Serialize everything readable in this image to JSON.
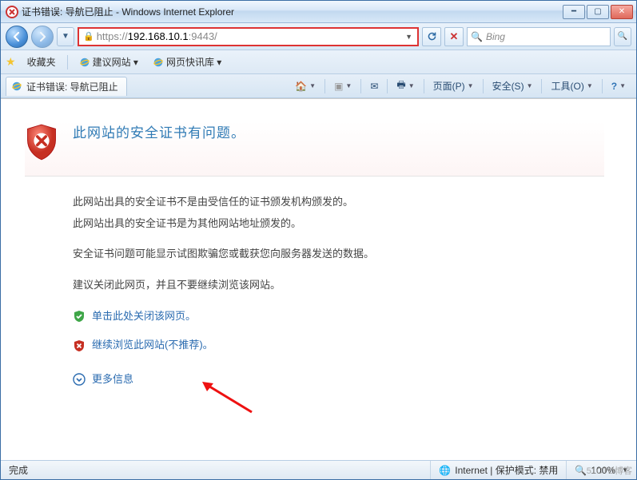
{
  "window": {
    "title": "证书错误: 导航已阻止 - Windows Internet Explorer"
  },
  "nav": {
    "url_scheme": "https://",
    "url_host": "192.168.10.1",
    "url_port": ":9443/",
    "search_placeholder": "Bing"
  },
  "favbar": {
    "label": "收藏夹",
    "suggested": "建议网站 ▾",
    "webslice": "网页快讯库 ▾"
  },
  "tab": {
    "title": "证书错误: 导航已阻止"
  },
  "toolbar": {
    "page": "页面(P)",
    "safety": "安全(S)",
    "tools": "工具(O)"
  },
  "cert": {
    "heading": "此网站的安全证书有问题。",
    "line1": "此网站出具的安全证书不是由受信任的证书颁发机构颁发的。",
    "line2": "此网站出具的安全证书是为其他网站地址颁发的。",
    "line3": "安全证书问题可能显示试图欺骗您或截获您向服务器发送的数据。",
    "line4": "建议关闭此网页，并且不要继续浏览该网站。",
    "close_link": "单击此处关闭该网页。",
    "continue_link": "继续浏览此网站(不推荐)。",
    "more_info": "更多信息"
  },
  "status": {
    "done": "完成",
    "zone": "Internet | 保护模式: 禁用",
    "zoom": "100%"
  },
  "watermark": "51CTO博客"
}
